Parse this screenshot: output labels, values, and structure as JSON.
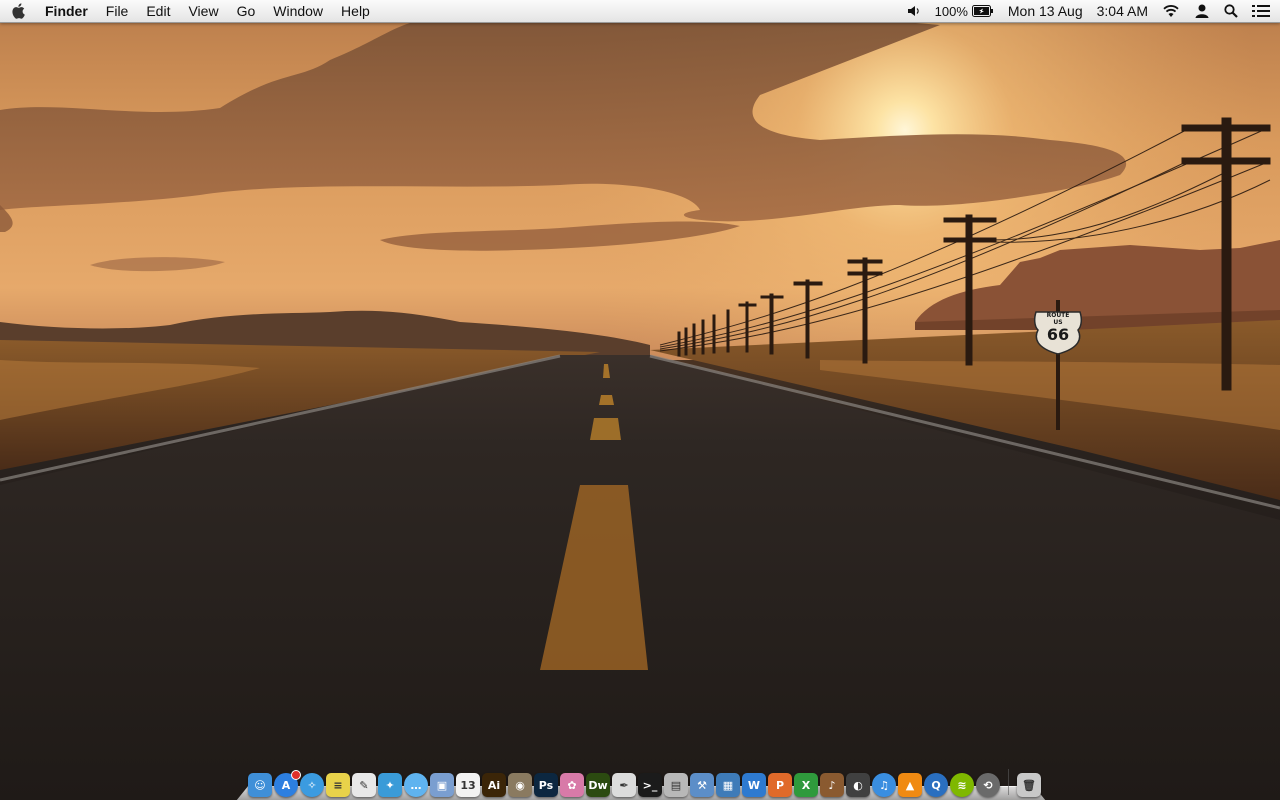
{
  "menubar": {
    "app_name": "Finder",
    "menus": [
      "File",
      "Edit",
      "View",
      "Go",
      "Window",
      "Help"
    ],
    "battery": "100%",
    "date": "Mon 13 Aug",
    "time": "3:04 AM"
  },
  "wallpaper": {
    "sign_line1": "ROUTE",
    "sign_line2": "US",
    "sign_number": "66"
  },
  "dock": {
    "apps": [
      {
        "name": "Finder",
        "icon": "finder-icon",
        "glyph": "☺",
        "color": "#3f8fd8"
      },
      {
        "name": "App Store",
        "icon": "app-store-icon",
        "glyph": "A",
        "color": "#2d7fe0",
        "round": true,
        "badge": true
      },
      {
        "name": "Safari",
        "icon": "safari-icon",
        "glyph": "✧",
        "color": "#3b9be0",
        "round": true
      },
      {
        "name": "Stickies",
        "icon": "stickies-icon",
        "glyph": "≡",
        "color": "#e8d24a"
      },
      {
        "name": "TextEdit",
        "icon": "textedit-icon",
        "glyph": "✎",
        "color": "#e8e8e8"
      },
      {
        "name": "Twitter",
        "icon": "twitter-icon",
        "glyph": "✦",
        "color": "#3a9bd8"
      },
      {
        "name": "Messages",
        "icon": "messages-icon",
        "glyph": "…",
        "color": "#5fb3ef",
        "round": true
      },
      {
        "name": "Preview",
        "icon": "preview-icon",
        "glyph": "▣",
        "color": "#7a9ed0"
      },
      {
        "name": "Calendar",
        "icon": "calendar-icon",
        "glyph": "13",
        "color": "#f2f2f2"
      },
      {
        "name": "Illustrator",
        "icon": "illustrator-icon",
        "glyph": "Ai",
        "color": "#3b2508"
      },
      {
        "name": "iPhoto",
        "icon": "iphoto-icon",
        "glyph": "◉",
        "color": "#8a7a60"
      },
      {
        "name": "Photoshop",
        "icon": "photoshop-icon",
        "glyph": "Ps",
        "color": "#0c2740"
      },
      {
        "name": "Photo Booth",
        "icon": "photobooth-icon",
        "glyph": "✿",
        "color": "#d87aa8"
      },
      {
        "name": "Dreamweaver",
        "icon": "dreamweaver-icon",
        "glyph": "Dw",
        "color": "#2b4a10"
      },
      {
        "name": "Script Editor",
        "icon": "script-editor-icon",
        "glyph": "✒",
        "color": "#dcdcdc"
      },
      {
        "name": "Terminal",
        "icon": "terminal-icon",
        "glyph": ">_",
        "color": "#1b1b1b"
      },
      {
        "name": "Image Capture",
        "icon": "image-capture-icon",
        "glyph": "▤",
        "color": "#b8b8b8"
      },
      {
        "name": "Xcode",
        "icon": "xcode-icon",
        "glyph": "⚒",
        "color": "#5c8ec8"
      },
      {
        "name": "VirtualBox",
        "icon": "virtualbox-icon",
        "glyph": "▦",
        "color": "#3e7bb8"
      },
      {
        "name": "Word",
        "icon": "word-icon",
        "glyph": "W",
        "color": "#2e7ad0"
      },
      {
        "name": "PowerPoint",
        "icon": "powerpoint-icon",
        "glyph": "P",
        "color": "#e06a2a"
      },
      {
        "name": "Excel",
        "icon": "excel-icon",
        "glyph": "X",
        "color": "#2f9a3c"
      },
      {
        "name": "GarageBand",
        "icon": "garageband-icon",
        "glyph": "♪",
        "color": "#8a5a30"
      },
      {
        "name": "Dashboard",
        "icon": "dashboard-icon",
        "glyph": "◐",
        "color": "#404040"
      },
      {
        "name": "iTunes",
        "icon": "itunes-icon",
        "glyph": "♫",
        "color": "#3a8ee0",
        "round": true
      },
      {
        "name": "VLC",
        "icon": "vlc-icon",
        "glyph": "▲",
        "color": "#f08a12"
      },
      {
        "name": "QuickTime",
        "icon": "quicktime-icon",
        "glyph": "Q",
        "color": "#2a6fc0",
        "round": true
      },
      {
        "name": "Spotify",
        "icon": "spotify-icon",
        "glyph": "≋",
        "color": "#7fb800",
        "round": true
      },
      {
        "name": "Time Machine",
        "icon": "time-machine-icon",
        "glyph": "⟲",
        "color": "#6a6a6a",
        "round": true
      }
    ],
    "trash": {
      "name": "Trash",
      "icon": "trash-icon",
      "glyph": "🗑",
      "color": "#c8c8c8"
    }
  }
}
